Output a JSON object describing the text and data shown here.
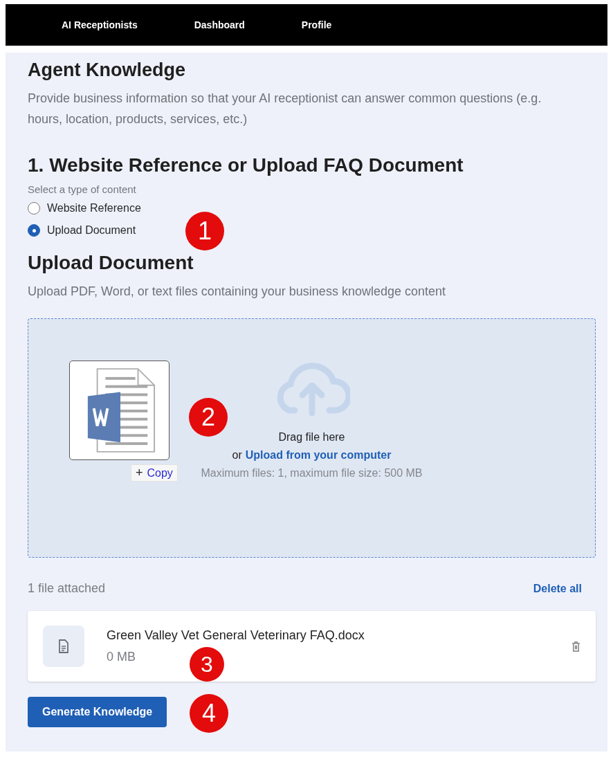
{
  "nav": {
    "items": [
      {
        "label": "AI Receptionists"
      },
      {
        "label": "Dashboard"
      },
      {
        "label": "Profile"
      }
    ]
  },
  "header": {
    "title": "Agent Knowledge",
    "description": "Provide business information so that your AI receptionist can answer common questions (e.g. hours, location, products, services, etc.)"
  },
  "section": {
    "title": "1. Website Reference or Upload FAQ Document",
    "hint": "Select a type of content",
    "options": [
      {
        "label": "Website Reference",
        "selected": false
      },
      {
        "label": "Upload Document",
        "selected": true
      }
    ]
  },
  "upload": {
    "title": "Upload Document",
    "description": "Upload PDF, Word, or text files containing your business knowledge content",
    "drag_text": "Drag file here",
    "or_text": "or",
    "link": "Upload from your computer",
    "limits": "Maximum files: 1, maximum file size: 500 MB",
    "drag_preview": {
      "tooltip_symbol": "+",
      "tooltip": "Copy"
    }
  },
  "files": {
    "count": "1 file attached",
    "delete_all": "Delete all",
    "items": [
      {
        "name": "Green Valley Vet General Veterinary FAQ.docx",
        "size": "0 MB"
      }
    ]
  },
  "generate_button": "Generate Knowledge",
  "annotations": [
    "1",
    "2",
    "3",
    "4"
  ]
}
